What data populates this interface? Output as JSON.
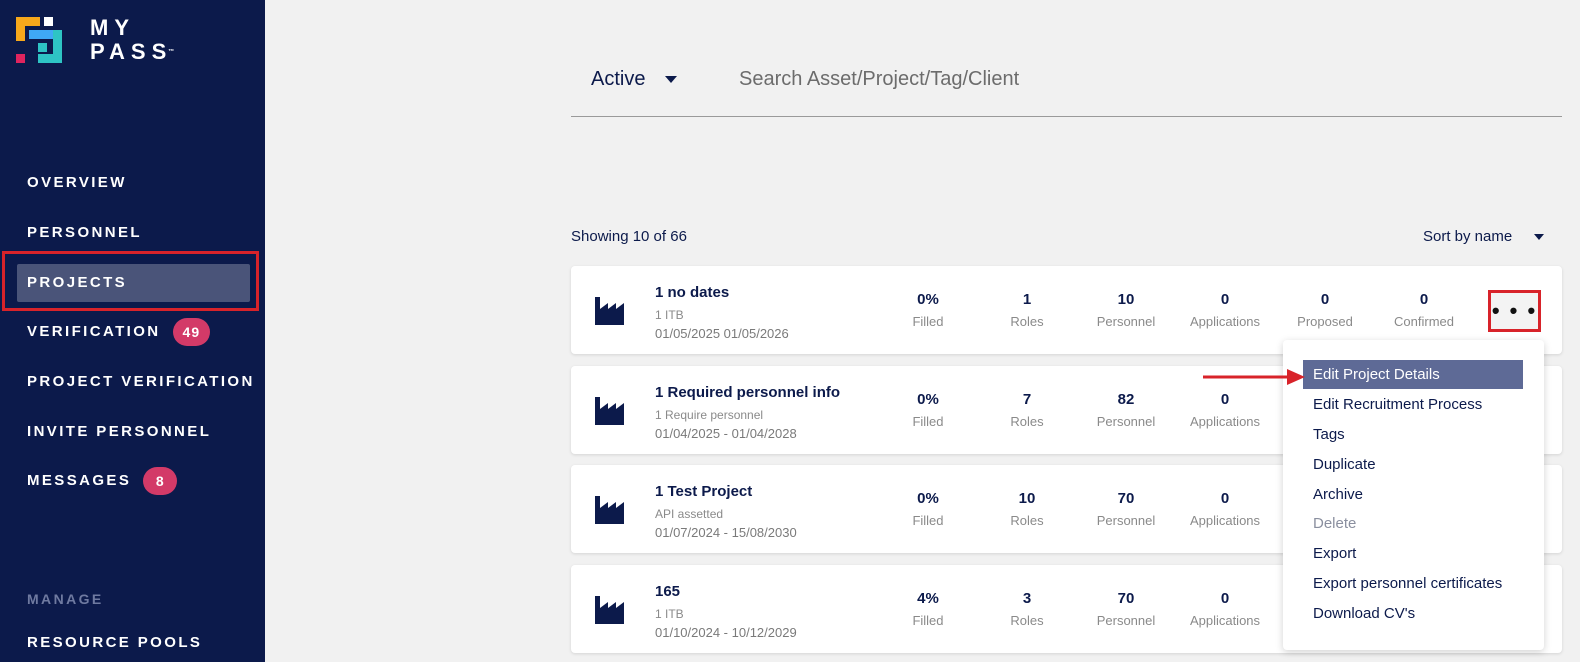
{
  "brand": {
    "line1": "MY",
    "line2": "PASS",
    "tm": "™"
  },
  "nav": {
    "overview": "OVERVIEW",
    "personnel": "PERSONNEL",
    "projects": "PROJECTS",
    "verification": "VERIFICATION",
    "verification_badge": "49",
    "project_verification": "PROJECT VERIFICATION",
    "invite_personnel": "INVITE PERSONNEL",
    "messages": "MESSAGES",
    "messages_badge": "8",
    "manage_section": "MANAGE",
    "resource_pools": "RESOURCE POOLS"
  },
  "filter": {
    "status": "Active",
    "search_placeholder": "Search Asset/Project/Tag/Client"
  },
  "list": {
    "showing": "Showing 10 of 66",
    "sort": "Sort by name"
  },
  "stat_labels": {
    "filled": "Filled",
    "roles": "Roles",
    "personnel": "Personnel",
    "applications": "Applications",
    "proposed": "Proposed",
    "confirmed": "Confirmed"
  },
  "projects": [
    {
      "title": "1 no dates",
      "sub": "1 ITB",
      "dates": "01/05/2025 01/05/2026",
      "filled": "0%",
      "roles": "1",
      "personnel": "10",
      "applications": "0",
      "proposed": "0",
      "confirmed": "0"
    },
    {
      "title": "1 Required personnel info",
      "sub": "1 Require personnel",
      "dates": "01/04/2025 - 01/04/2028",
      "filled": "0%",
      "roles": "7",
      "personnel": "82",
      "applications": "0"
    },
    {
      "title": "1 Test Project",
      "sub": "API assetted",
      "dates": "01/07/2024 - 15/08/2030",
      "filled": "0%",
      "roles": "10",
      "personnel": "70",
      "applications": "0"
    },
    {
      "title": "165",
      "sub": "1 ITB",
      "dates": "01/10/2024 - 10/12/2029",
      "filled": "4%",
      "roles": "3",
      "personnel": "70",
      "applications": "0"
    }
  ],
  "more_button": "• • •",
  "menu": {
    "edit_details": "Edit Project Details",
    "edit_recruitment": "Edit Recruitment Process",
    "tags": "Tags",
    "duplicate": "Duplicate",
    "archive": "Archive",
    "delete": "Delete",
    "export": "Export",
    "export_certificates": "Export personnel certificates",
    "download_cvs": "Download CV's"
  },
  "colors": {
    "sidebar": "#0c1a4b",
    "badge": "#d33a68",
    "highlight": "#d8232a",
    "menu_active": "#5e6a96"
  }
}
